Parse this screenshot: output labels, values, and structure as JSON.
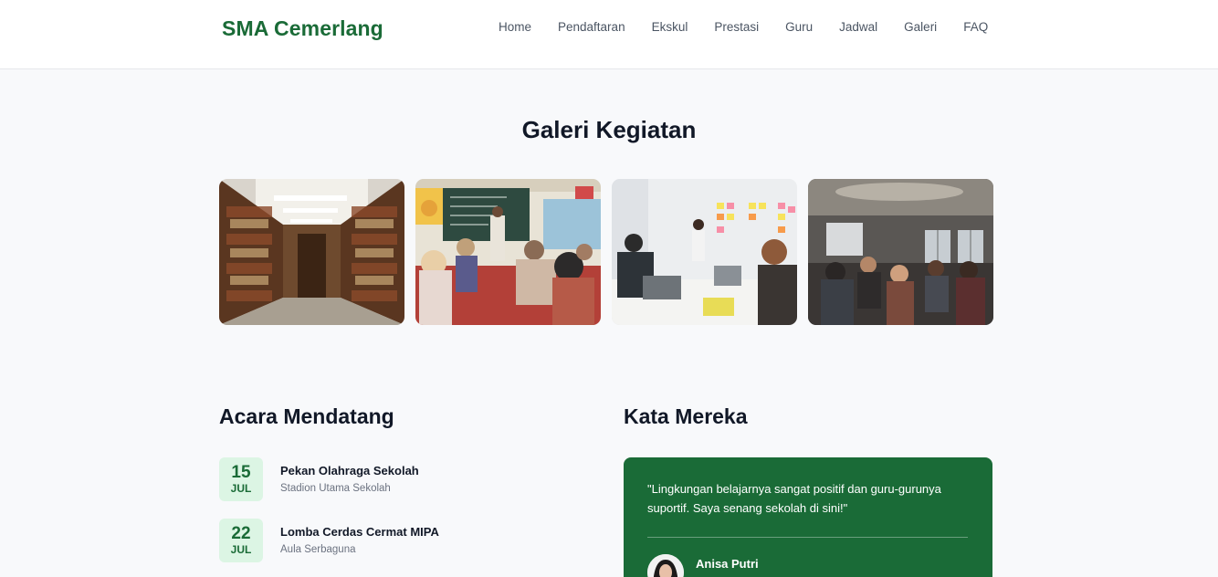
{
  "header": {
    "brand": "SMA Cemerlang",
    "nav": [
      "Home",
      "Pendaftaran",
      "Ekskul",
      "Prestasi",
      "Guru",
      "Jadwal",
      "Galeri",
      "FAQ"
    ]
  },
  "gallery": {
    "title": "Galeri Kegiatan"
  },
  "events": {
    "title": "Acara Mendatang",
    "items": [
      {
        "day": "15",
        "month": "JUL",
        "title": "Pekan Olahraga Sekolah",
        "place": "Stadion Utama Sekolah"
      },
      {
        "day": "22",
        "month": "JUL",
        "title": "Lomba Cerdas Cermat MIPA",
        "place": "Aula Serbaguna"
      }
    ]
  },
  "testimonials": {
    "title": "Kata Mereka",
    "quote": "\"Lingkungan belajarnya sangat positif dan guru-gurunya suportif. Saya senang sekolah di sini!\"",
    "author": "Anisa Putri"
  },
  "colors": {
    "brand": "#1a6b37",
    "badge_bg": "#dcf5e4",
    "page_bg": "#f8f9fb"
  }
}
